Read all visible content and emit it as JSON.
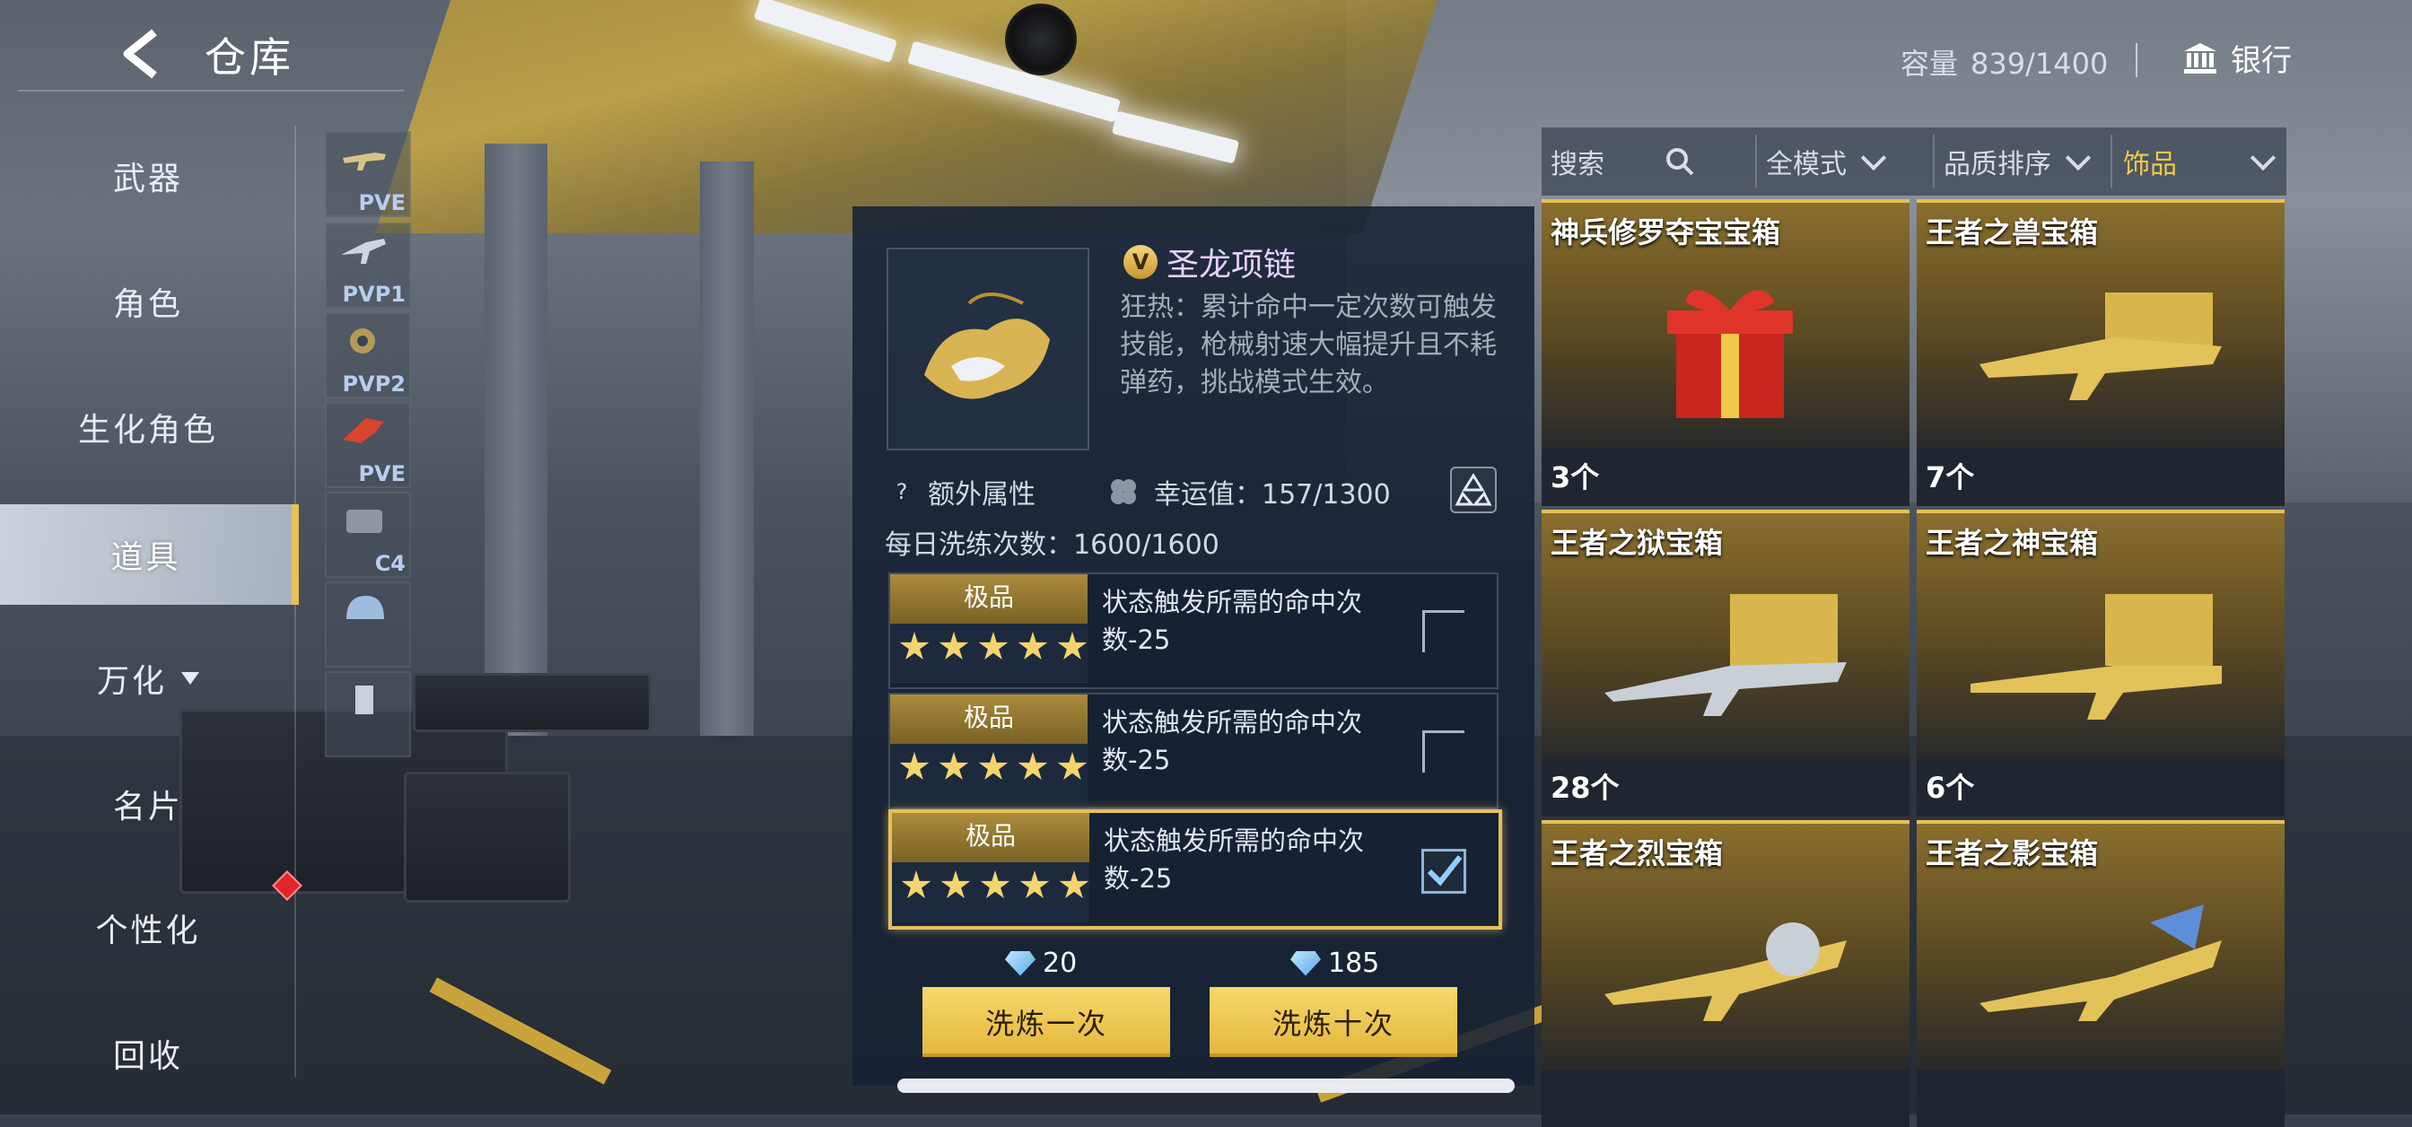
{
  "header": {
    "title": "仓库",
    "capacity_label": "容量",
    "capacity_value": "839/1400",
    "bank_label": "银行"
  },
  "nav": {
    "items": [
      {
        "label": "武器"
      },
      {
        "label": "角色"
      },
      {
        "label": "生化角色"
      },
      {
        "label": "道具"
      },
      {
        "label": "万化"
      },
      {
        "label": "名片"
      },
      {
        "label": "个性化"
      },
      {
        "label": "回收"
      }
    ],
    "active_index": 3
  },
  "subcategories": [
    {
      "label": "PVE",
      "icon": "gun-icon"
    },
    {
      "label": "PVP1",
      "icon": "gun-icon"
    },
    {
      "label": "PVP2",
      "icon": "gear-icon"
    },
    {
      "label": "PVE",
      "icon": "blade-icon"
    },
    {
      "label": "C4",
      "icon": "bomb-icon"
    },
    {
      "label": "",
      "icon": "helmet-icon"
    },
    {
      "label": "",
      "icon": "figure-icon"
    }
  ],
  "detail": {
    "item_name": "圣龙项链",
    "badge": "V",
    "description": "狂热：累计命中一定次数可触发技能，枪械射速大幅提升且不耗弹药，挑战模式生效。",
    "extra_attr_label": "额外属性",
    "luck_text": "幸运值：157/1300",
    "daily_text": "每日洗练次数：1600/1600",
    "options": [
      {
        "grade": "极品",
        "stars": 5,
        "text": "状态触发所需的命中次数-25",
        "checked": false
      },
      {
        "grade": "极品",
        "stars": 5,
        "text": "状态触发所需的命中次数-25",
        "checked": false
      },
      {
        "grade": "极品",
        "stars": 5,
        "text": "状态触发所需的命中次数-25",
        "checked": true
      }
    ],
    "cost_once": "20",
    "cost_ten": "185",
    "btn_once": "洗炼一次",
    "btn_ten": "洗炼十次"
  },
  "filters": {
    "search_placeholder": "搜索",
    "mode": "全模式",
    "sort": "品质排序",
    "category": "饰品",
    "accent": "#f2c94c"
  },
  "items": [
    {
      "name": "神兵修罗夺宝宝箱",
      "count": "3个",
      "icon": "giftbox-icon"
    },
    {
      "name": "王者之兽宝箱",
      "count": "7个",
      "icon": "rifle-icon"
    },
    {
      "name": "王者之狱宝箱",
      "count": "28个",
      "icon": "rifle-icon"
    },
    {
      "name": "王者之神宝箱",
      "count": "6个",
      "icon": "sniper-icon"
    },
    {
      "name": "王者之烈宝箱",
      "count": "",
      "icon": "rifle-icon"
    },
    {
      "name": "王者之影宝箱",
      "count": "",
      "icon": "rifle-icon"
    }
  ]
}
